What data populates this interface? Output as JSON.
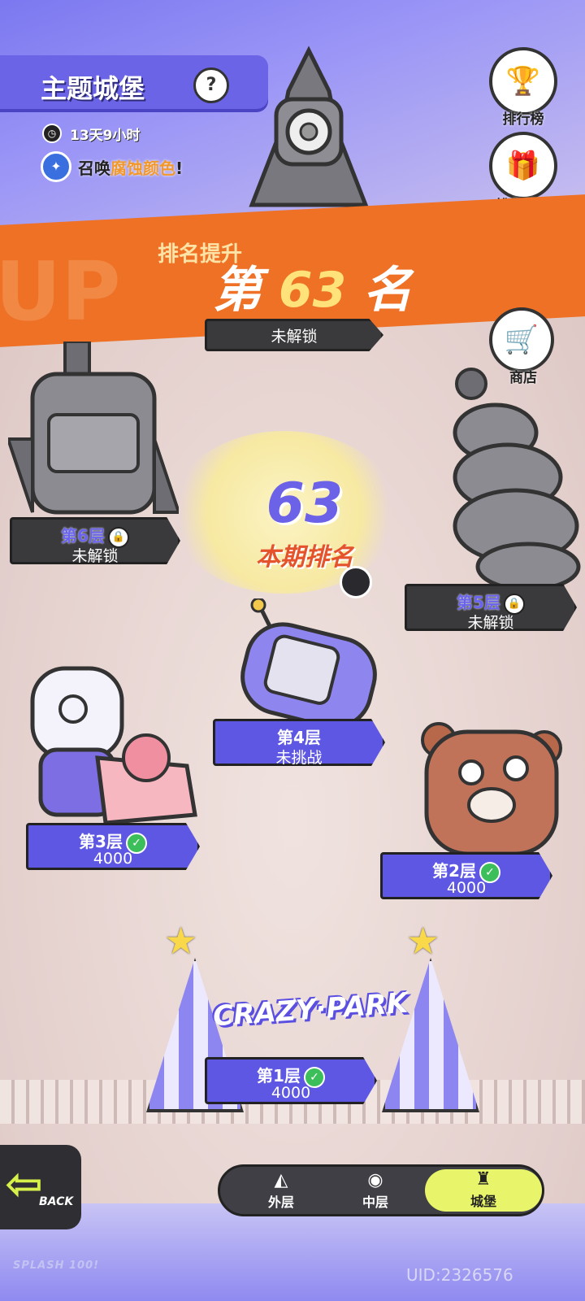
{
  "header": {
    "title": "主题城堡",
    "help": "?",
    "timer": "13天9小时",
    "summon_prefix": "召唤",
    "summon_highlight": "腐蚀颜色",
    "summon_suffix": "!"
  },
  "side_buttons": {
    "leaderboard": "排行榜",
    "rank_rewards": "排名奖励",
    "shop": "商店"
  },
  "banner": {
    "small": "排名提升",
    "prefix": "第",
    "number": "63",
    "suffix": "名",
    "watermark": "UP"
  },
  "rank": {
    "number": "63",
    "label": "本期排名"
  },
  "floors": {
    "f7_status": "未解锁",
    "f6_title": "第6层",
    "f6_status": "未解锁",
    "f5_title": "第5层",
    "f5_status": "未解锁",
    "f4_title": "第4层",
    "f4_status": "未挑战",
    "f3_title": "第3层",
    "f3_score": "4000",
    "f2_title": "第2层",
    "f2_score": "4000",
    "f1_title": "第1层",
    "f1_score": "4000"
  },
  "park_sign": "CRAZY·PARK",
  "bottom_nav": {
    "outer": "外层",
    "middle": "中层",
    "castle": "城堡"
  },
  "back_label": "BACK",
  "brand": "SPLASH 100!",
  "uid": "UID:2326576",
  "colors": {
    "accent": "#6b64e6",
    "banner": "#ee7126",
    "highlight": "#f2982a",
    "nav_active": "#e8f56a"
  }
}
